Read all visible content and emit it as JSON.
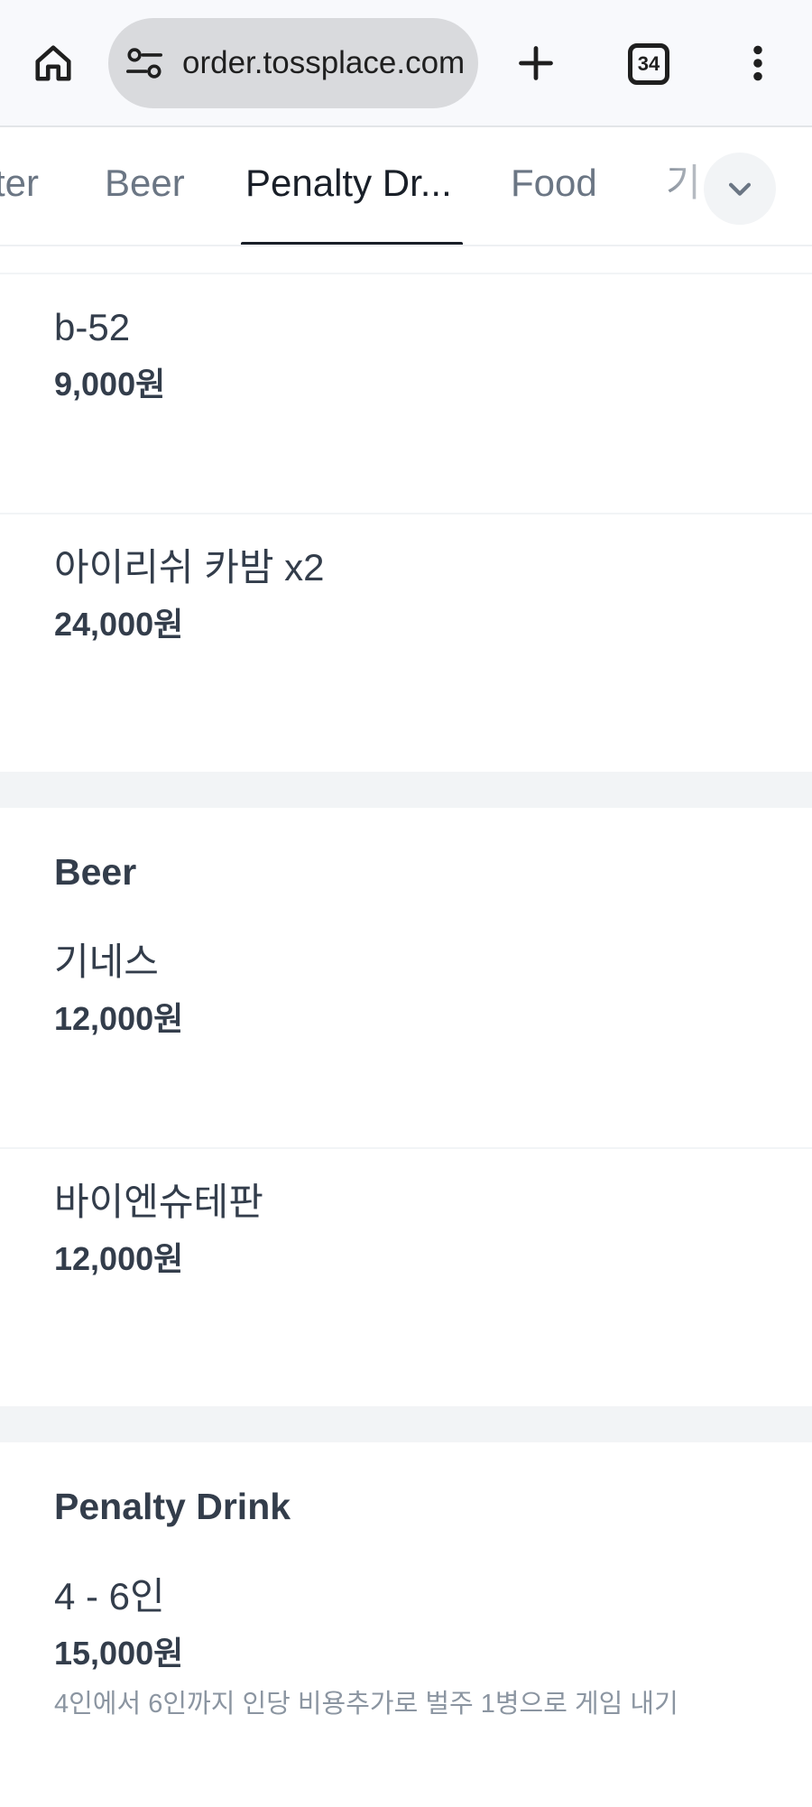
{
  "browser": {
    "url": "order.tossplace.com",
    "tab_count": "34",
    "icons": [
      "home-icon",
      "site-settings-icon",
      "new-tab-plus-icon",
      "tab-switcher-icon",
      "more-vert-icon"
    ]
  },
  "categories": {
    "tabs": [
      {
        "label": "ter",
        "active": false
      },
      {
        "label": "Beer",
        "active": false
      },
      {
        "label": "Penalty Dr...",
        "active": true
      },
      {
        "label": "Food",
        "active": false
      },
      {
        "label": "기",
        "active": false
      }
    ],
    "expand_icon": "chevron-down-icon"
  },
  "menu": {
    "top_items": [
      {
        "name": "b-52",
        "price": "9,000원"
      },
      {
        "name": "아이리쉬 카밤 x2",
        "price": "24,000원"
      }
    ],
    "beer": {
      "title": "Beer",
      "items": [
        {
          "name": "기네스",
          "price": "12,000원"
        },
        {
          "name": "바이엔슈테판",
          "price": "12,000원"
        }
      ]
    },
    "penalty": {
      "title": "Penalty Drink",
      "items": [
        {
          "name": "4 - 6인",
          "price": "15,000원",
          "desc": "4인에서 6인까지 인당 비용추가로 벌주 1병으로 게임 내기"
        }
      ]
    }
  },
  "colors": {
    "active_tab": "#191f28",
    "inactive_tab": "#6b7684",
    "text": "#333d4b",
    "subtext": "#8b95a1",
    "divider": "#f2f4f6"
  }
}
